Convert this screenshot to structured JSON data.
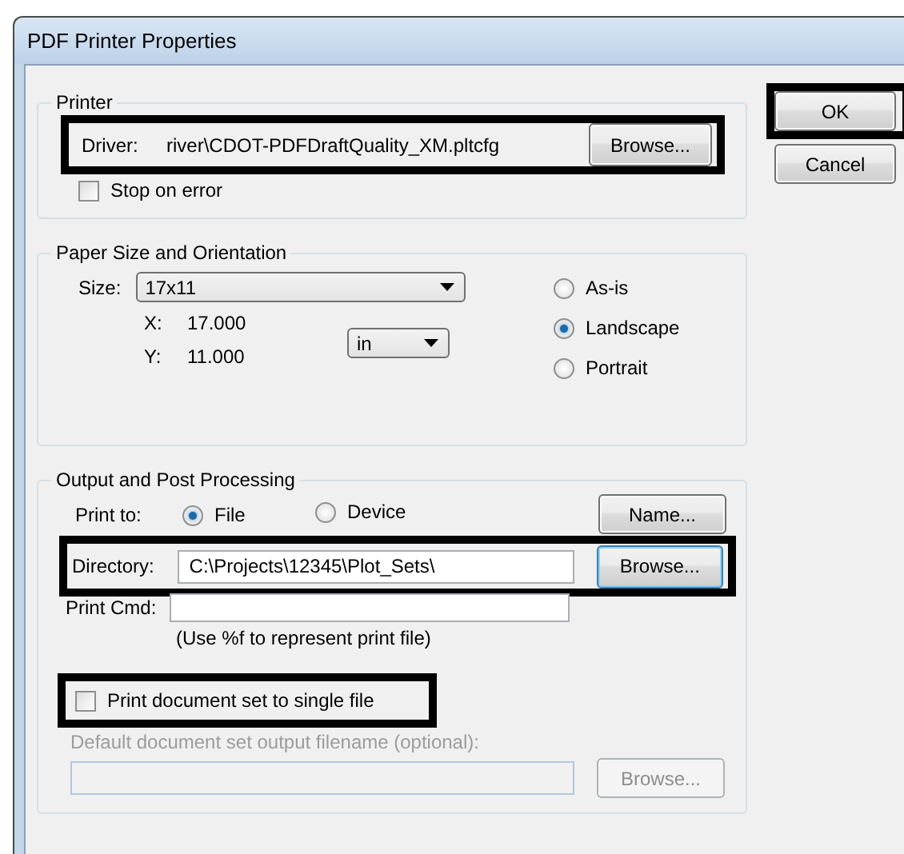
{
  "window": {
    "title": "PDF Printer Properties"
  },
  "buttons": [
    {
      "label": "OK",
      "highlighted": true,
      "focused": false
    },
    {
      "label": "Cancel",
      "highlighted": false,
      "focused": false
    }
  ],
  "printer": {
    "title": "Printer",
    "driver": {
      "label": "Driver:",
      "value": "river\\CDOT-PDFDraftQuality_XM.pltcfg",
      "button": "Browse...",
      "highlighted": true
    },
    "stop_on_error": {
      "label": "Stop on error",
      "checked": false
    }
  },
  "paper": {
    "title": "Paper Size and Orientation",
    "size": {
      "label": "Size:",
      "value": "17x11"
    },
    "x": {
      "label": "X:",
      "value": "17.000"
    },
    "y": {
      "label": "Y:",
      "value": "11.000"
    },
    "units": "in",
    "orientation": [
      {
        "label": "As-is",
        "selected": false
      },
      {
        "label": "Landscape",
        "selected": true
      },
      {
        "label": "Portrait",
        "selected": false
      }
    ]
  },
  "output": {
    "title": "Output and Post Processing",
    "print_to": {
      "label": "Print to:",
      "options": [
        {
          "label": "File",
          "selected": true
        },
        {
          "label": "Device",
          "selected": false
        }
      ]
    },
    "name_button": "Name...",
    "directory": {
      "label": "Directory:",
      "value": "C:\\Projects\\12345\\Plot_Sets\\",
      "button": "Browse...",
      "button_focused": true,
      "highlighted": true
    },
    "print_cmd": {
      "label": "Print Cmd:",
      "hint": "(Use %f to represent print file)"
    },
    "single_file": {
      "label": "Print document set to single file",
      "checked": false,
      "highlighted": true
    },
    "default_filename": {
      "label": "Default document set output filename (optional):",
      "button": "Browse...",
      "disabled": true
    }
  }
}
